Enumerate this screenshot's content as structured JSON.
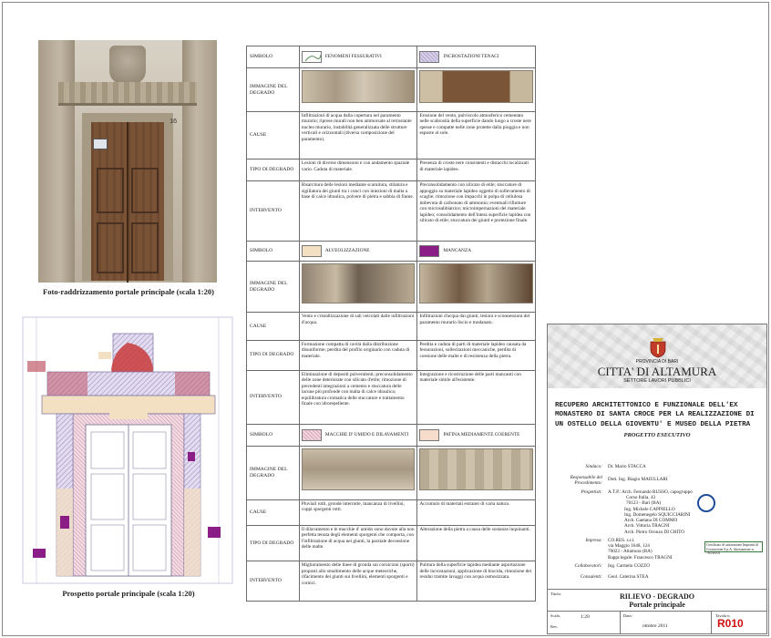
{
  "photo": {
    "caption": "Foto-raddrizzamento portale principale (scala 1:20)",
    "house_number": "16"
  },
  "elevation": {
    "caption": "Prospetto portale principale (scala 1:20)"
  },
  "table_labels": {
    "simbolo": "SIMBOLO",
    "immagine": "IMMAGINE DEL DEGRADO",
    "cause": "CAUSE",
    "tipo": "TIPO DI DEGRADO",
    "intervento": "INTERVENTO"
  },
  "degrado": [
    {
      "left": {
        "symbol": "FENOMENI FESSURATIVI",
        "cause": "Infiltrazioni di acqua dalla copertura nel paramento murario; riprese murali non ben ammorsate al retrostante nucleo murario, instabilità generalizzata delle strutture verticali e orizzontali (diversa composizione del paramento).",
        "tipo": "Lesioni di diverse dimensioni e con andamento spaziale vario. Caduta di materiale.",
        "intervento": "Risarcitura delle lesioni mediante scarnitura, stilatura e sigillatura dei giunti tra i conci con iniezioni di malta a base di calce idraulica, polvere di pietra e sabbia di fiume."
      },
      "right": {
        "symbol": "INCROSTAZIONI TENACI",
        "cause": "Erosione del vento, pulviscolo atmosferico cementato nelle scabrosità della superficie dando luogo a croste nere spesse e compatte nelle zone protette dalla pioggia e non esposte al sole.",
        "tipo": "Presenza di croste nere consistenti e distacchi localizzati di materiale lapideo.",
        "intervento": "Preconsolidamento con silicato di etile; stuccature di appoggio su materiale lapideo oggetto di sollevamento di scaglie; rimozione con impacchi in polpa di cellulosa imbevuta di carbonato di ammonio; eventuali rifiniture con microsabbiatrice; microimpernazioni del materiale lapideo; consolidamento dell'intera superficie lapidea con silicato di etile; stuccatura dei giunti e protezione finale."
      }
    },
    {
      "left": {
        "symbol": "ALVEOLIZZAZIONE",
        "cause": "Vento e cristallizzazione di sali veicolati dalle infiltrazioni d'acqua.",
        "tipo": "Formazione compatta di cavità dalla distribuzione disuniforme; perdita del profilo originario con caduta di materiale.",
        "intervento": "Eliminazione di depositi polverulenti; preconsolidamento delle zone deteriorate con silicato d'etile; rimozione di precedenti integrazioni a cemento e stuccatura delle lacune più profonde con malta di calce idraulica; equilibratura cromatica delle stuccature e trattamento finale con idrorepellente."
      },
      "right": {
        "symbol": "MANCANZA",
        "cause": "Infiltrazioni d'acqua dai giunti, lesioni e sconnessioni del paramento murario liscio e modanato.",
        "tipo": "Perdita e caduta di parti di materiale lapideo causata da fessurazioni, sollecitazioni meccaniche, perdita di coesione delle malte e di resistenza della pietra.",
        "intervento": "Integrazione e ricostruzione delle parti mancanti con materiale simile all'esistente."
      }
    },
    {
      "left": {
        "symbol": "MACCHIE D' UMIDO E DILAVAMENTI",
        "cause": "Pluviali rotti, gronde interrotte, mancanza di livellini, coppi sporgenti rotti.",
        "tipo": "Il dilavamento e le macchie d' umido sono dovute alla non perfetta tenuta degli elementi sporgenti che comporta, con l'infiltrazione di acqua nei giunti, la parziale decoesione delle malte.",
        "intervento": "Miglioramento delle linee di gronda sui cornicioni (sporti) proposti allo smaltimento delle acque meteoriche, rifacimento dei giunti sui livellini, elementi sporgenti e cornici."
      },
      "right": {
        "symbol": "PATINA MEDIAMENTE COERENTE",
        "cause": "Accumulo di materiali estranei di varia natura.",
        "tipo": "Alterazione della pietra a causa delle sostanze inquinanti.",
        "intervento": "Pulitura della superficie lapidea mediante asportazione delle incrostazioni, applicazione di biocida, rimozione dei residui tramite lavaggi con acqua osmosizzata."
      }
    }
  ],
  "titleblock": {
    "province": "PROVINCIA DI BARI",
    "city": "CITTA' DI ALTAMURA",
    "settore": "SETTORE LAVORI PUBBLICI",
    "project_lines": [
      "RECUPERO ARCHITETTONICO E FUNZIONALE DELL'EX",
      "MONASTERO DI SANTA CROCE PER LA REALIZZAZIONE DI",
      "UN OSTELLO DELLA GIOVENTU' E MUSEO DELLA PIETRA"
    ],
    "phase": "PROGETTO ESECUTIVO",
    "sindaco_label": "Sindaco:",
    "sindaco": "Dr. Mario STACCA",
    "resp_label": "Responsabile del Procedimento:",
    "resp": "Dott. Ing. Biagio MAIULLARI",
    "prog_label": "Progettisti:",
    "prog_lines": [
      "A.T.P.: Arch. Fernando RUSSO, capogruppo",
      "Corso Italia, 43",
      "70123 - Bari (BA)",
      "Ing. Michele CAPPIELLO",
      "Ing. Domenegelo SQUICCIARINI",
      "Arch. Gaetana DI COMMO",
      "Arch. Vittoria TRAGNI",
      "Arch. Pietro Oronzo DI CHITO"
    ],
    "impresa_label": "Impresa:",
    "impresa_lines": [
      "CO.RES. s.r.l.",
      "via Maggio 1648, 124",
      "70022 - Altamura (BA)",
      "Rappr.legale: Francesco TRAGNI"
    ],
    "coll_label": "Collaboratori:",
    "coll": "Ing. Carmelo COZZO",
    "cons_label": "Consulenti:",
    "cons": "Geol. Caterina STEA",
    "cert_text": "Certificato di attestazione Impianti di Costruzione S.p.A. Attestazione n. 765/63/01",
    "titolo_label": "Titolo:",
    "titolo_line1": "RILIEVO - DEGRADO",
    "titolo_line2": "Portale principale",
    "scala_label": "Scala:",
    "scala": "1:20",
    "data_label": "Data:",
    "data": "ottobre 2011",
    "rev_label": "Rev.",
    "tavola_label": "Tavola n.",
    "tavola": "R010"
  },
  "colors": {
    "alveolizzazione": "#f3dfc2",
    "mancanza": "#8a1e86",
    "incrostazioni": "#b2a5cc",
    "umido": "#d9a7b8",
    "code_red": "#d01010"
  }
}
